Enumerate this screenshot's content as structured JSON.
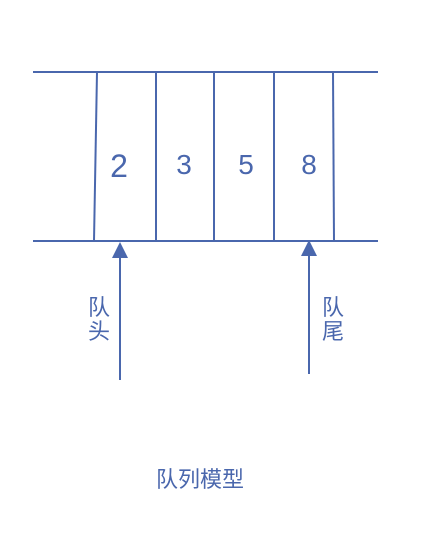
{
  "diagram": {
    "cells": [
      "2",
      "3",
      "5",
      "8"
    ],
    "head_label": "队头",
    "tail_label": "队尾",
    "caption": "队列模型"
  },
  "colors": {
    "line": "#4a67ad",
    "text": "#4a67ad",
    "background": "#ffffff"
  }
}
